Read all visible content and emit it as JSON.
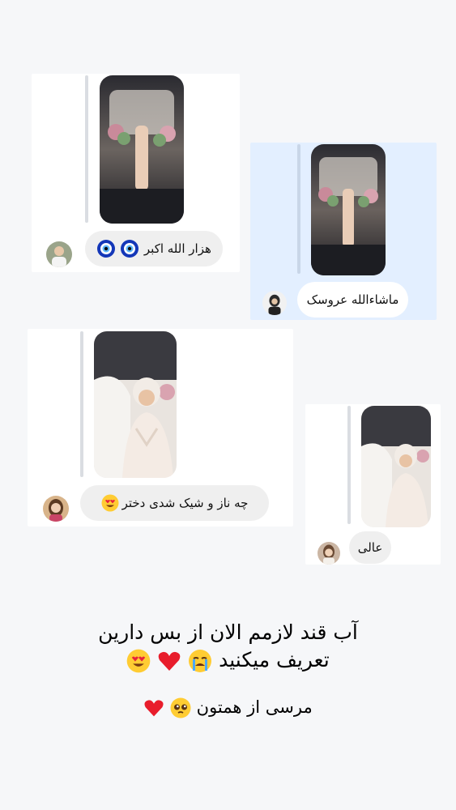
{
  "comments": [
    {
      "id": "c1",
      "text": "هزار الله اکبر",
      "emojis": [
        "nazar-amulet",
        "nazar-amulet"
      ],
      "avatar": "man-portrait"
    },
    {
      "id": "c2",
      "text": "ماشاءالله عروسک",
      "emojis": [],
      "avatar": "woman-hijab-portrait"
    },
    {
      "id": "c3",
      "text": "چه ناز و شیک شدی دختر",
      "emojis": [
        "heart-eyes"
      ],
      "avatar": "woman-portrait"
    },
    {
      "id": "c4",
      "text": "عالی",
      "emojis": [],
      "avatar": "woman-portrait-2"
    }
  ],
  "caption": {
    "line1": "آب قند لازمم الان از بس دارین",
    "line2": "تعریف میکنید",
    "line2_emojis": [
      "crying-face",
      "red-heart",
      "heart-eyes"
    ],
    "line3": "مرسی از همتون",
    "line3_emojis": [
      "pleading-face",
      "red-heart"
    ]
  },
  "colors": {
    "background": "#f6f7f9",
    "card_white": "#ffffff",
    "card_blue": "#e3efff",
    "bubble": "#efefef",
    "text": "#000000"
  }
}
